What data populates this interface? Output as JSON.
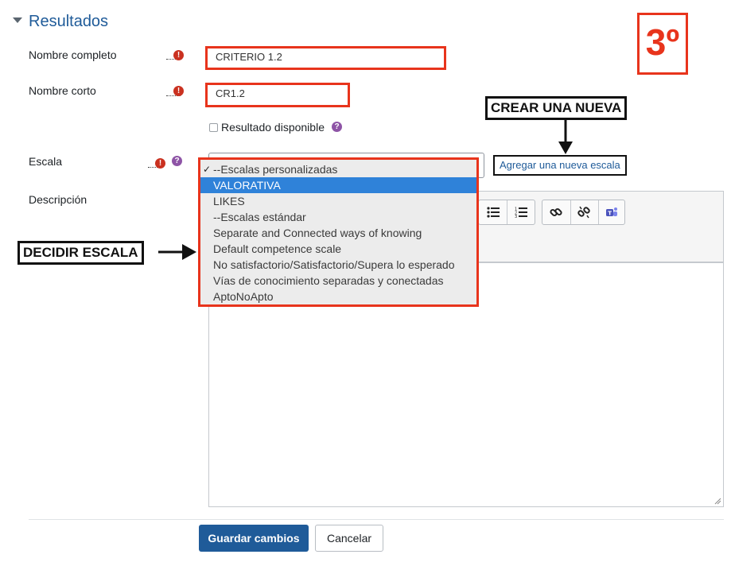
{
  "section": {
    "title": "Resultados"
  },
  "fields": {
    "fullname": {
      "label": "Nombre completo",
      "value": "CRITERIO 1.2"
    },
    "shortname": {
      "label": "Nombre corto",
      "value": "CR1.2"
    },
    "available": {
      "label": "Resultado disponible"
    },
    "scale": {
      "label": "Escala"
    },
    "description": {
      "label": "Descripción"
    }
  },
  "scale_options": [
    {
      "label": "--Escalas personalizadas",
      "checked": true
    },
    {
      "label": "VALORATIVA",
      "highlighted": true
    },
    {
      "label": "LIKES"
    },
    {
      "label": "--Escalas estándar"
    },
    {
      "label": "Separate and Connected ways of knowing"
    },
    {
      "label": "Default competence scale"
    },
    {
      "label": "No satisfactorio/Satisfactorio/Supera lo esperado"
    },
    {
      "label": "Vías de conocimiento separadas y conectadas"
    },
    {
      "label": "AptoNoApto"
    }
  ],
  "links": {
    "add_scale": "Agregar una nueva escala"
  },
  "annotations": {
    "step": "3º",
    "create_new": "CREAR UNA NUEVA",
    "choose_scale": "DECIDIR ESCALA"
  },
  "buttons": {
    "save": "Guardar cambios",
    "cancel": "Cancelar"
  },
  "icons": {
    "collapse": "caret-down-icon",
    "required": "exclamation-icon",
    "help": "question-icon",
    "toolbar": [
      "unordered-list-icon",
      "ordered-list-icon",
      "link-icon",
      "unlink-icon",
      "teams-icon"
    ]
  },
  "colors": {
    "accent": "#1f5b99",
    "annotation_red": "#e8341c",
    "required_red": "#ca3120",
    "help_purple": "#8e54a6",
    "selected_blue": "#2f82d9"
  }
}
